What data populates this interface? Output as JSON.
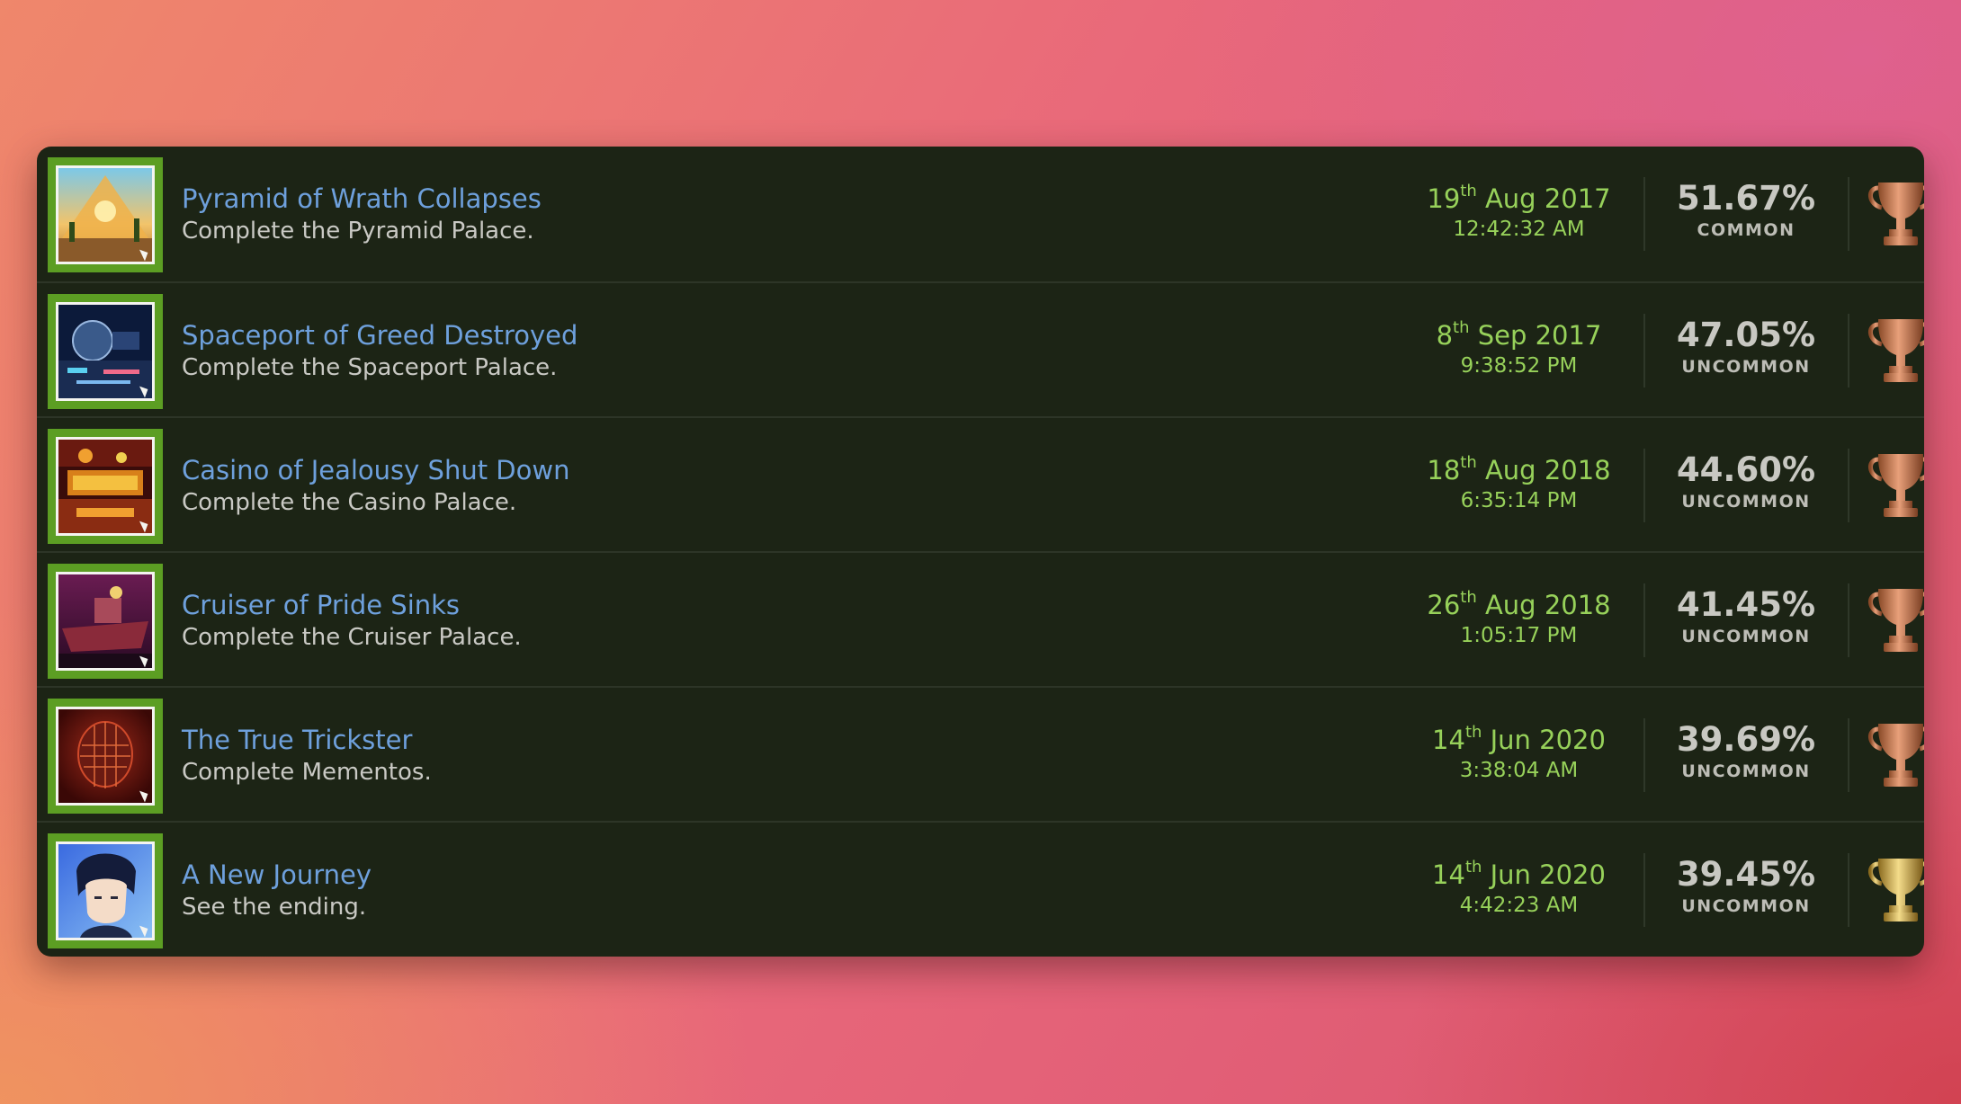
{
  "trophies": [
    {
      "title": "Pyramid of Wrath Collapses",
      "description": "Complete the Pyramid Palace.",
      "date_day": "19",
      "date_suffix": "th",
      "date_rest": "Aug 2017",
      "time": "12:42:32 AM",
      "percent": "51.67%",
      "rarity": "COMMON",
      "trophy_grade": "bronze",
      "image_icon": "pyramid-palace-icon"
    },
    {
      "title": "Spaceport of Greed Destroyed",
      "description": "Complete the Spaceport Palace.",
      "date_day": "8",
      "date_suffix": "th",
      "date_rest": "Sep 2017",
      "time": "9:38:52 PM",
      "percent": "47.05%",
      "rarity": "UNCOMMON",
      "trophy_grade": "bronze",
      "image_icon": "spaceport-palace-icon"
    },
    {
      "title": "Casino of Jealousy Shut Down",
      "description": "Complete the Casino Palace.",
      "date_day": "18",
      "date_suffix": "th",
      "date_rest": "Aug 2018",
      "time": "6:35:14 PM",
      "percent": "44.60%",
      "rarity": "UNCOMMON",
      "trophy_grade": "bronze",
      "image_icon": "casino-palace-icon"
    },
    {
      "title": "Cruiser of Pride Sinks",
      "description": "Complete the Cruiser Palace.",
      "date_day": "26",
      "date_suffix": "th",
      "date_rest": "Aug 2018",
      "time": "1:05:17 PM",
      "percent": "41.45%",
      "rarity": "UNCOMMON",
      "trophy_grade": "bronze",
      "image_icon": "cruiser-palace-icon"
    },
    {
      "title": "The True Trickster",
      "description": "Complete Mementos.",
      "date_day": "14",
      "date_suffix": "th",
      "date_rest": "Jun 2020",
      "time": "3:38:04 AM",
      "percent": "39.69%",
      "rarity": "UNCOMMON",
      "trophy_grade": "bronze",
      "image_icon": "mementos-icon"
    },
    {
      "title": "A New Journey",
      "description": "See the ending.",
      "date_day": "14",
      "date_suffix": "th",
      "date_rest": "Jun 2020",
      "time": "4:42:23 AM",
      "percent": "39.45%",
      "rarity": "UNCOMMON",
      "trophy_grade": "gold",
      "image_icon": "protagonist-portrait-icon"
    }
  ],
  "colors": {
    "title": "#6ea0dc",
    "date": "#97d15a",
    "panel": "#1c2415",
    "thumb_frame": "#5c9e23",
    "bronze": "#c8744a",
    "gold": "#d6ae4a"
  }
}
